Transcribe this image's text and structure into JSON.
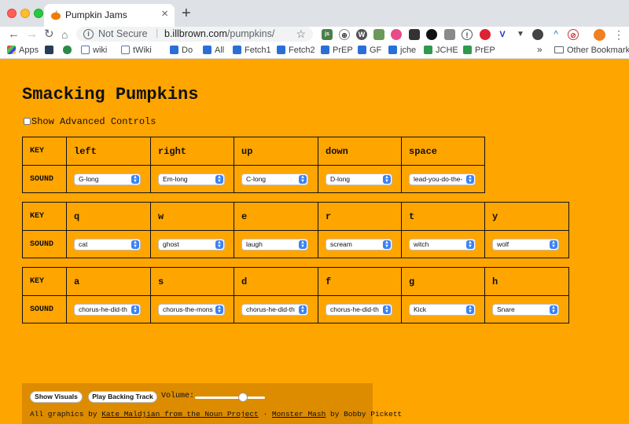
{
  "browser": {
    "tab_title": "Pumpkin Jams",
    "new_tab": "+",
    "tab_close": "×",
    "security_label": "Not Secure",
    "url_host": "b.illbrown.com",
    "url_path": "/pumpkins/",
    "bookmarks": [
      "Apps",
      "wiki",
      "tWiki",
      "Do",
      "All",
      "Fetch1",
      "Fetch2",
      "PrEP",
      "GF",
      "jche",
      "JCHE",
      "PrEP"
    ],
    "bookmarks_more": "»",
    "other_bookmarks": "Other Bookmarks"
  },
  "page": {
    "title": "Smacking Pumpkins",
    "advanced_label": "Show Advanced Controls",
    "key_label": "KEY",
    "sound_label": "SOUND"
  },
  "tables": [
    {
      "keys": [
        "left",
        "right",
        "up",
        "down",
        "space"
      ],
      "sounds": [
        "G-long",
        "Em-long",
        "C-long",
        "D-long",
        "lead-you-do-the-"
      ]
    },
    {
      "keys": [
        "q",
        "w",
        "e",
        "r",
        "t",
        "y"
      ],
      "sounds": [
        "cat",
        "ghost",
        "laugh",
        "scream",
        "witch",
        "wolf"
      ]
    },
    {
      "keys": [
        "a",
        "s",
        "d",
        "f",
        "g",
        "h"
      ],
      "sounds": [
        "chorus-he-did-th",
        "chorus-the-mons",
        "chorus-he-did-th",
        "chorus-he-did-th",
        "Kick",
        "Snare"
      ]
    }
  ],
  "footer": {
    "show_visuals": "Show Visuals",
    "play_backing": "Play Backing Track",
    "volume_label": "Volume:",
    "volume_level": 0.68,
    "credit_prefix": "All graphics by",
    "credit_link1": "Kate Maldjian from the Noun Project",
    "credit_sep": "·",
    "credit_link2": "Monster Mash",
    "credit_suffix": "by Bobby Pickett"
  },
  "colors": {
    "page_bg": "#ffa500",
    "footer_bg": "#dd8c00"
  }
}
